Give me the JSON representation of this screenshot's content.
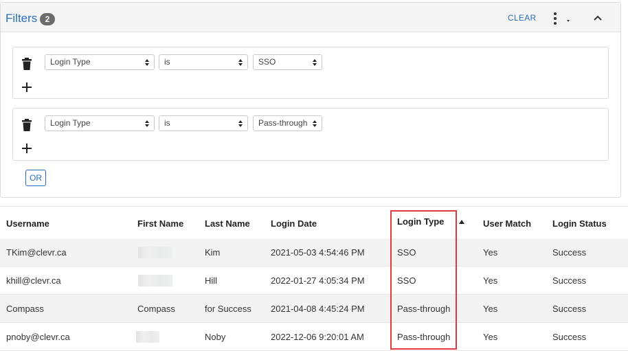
{
  "filters": {
    "title": "Filters",
    "count": "2",
    "clear_label": "CLEAR",
    "icons": {
      "delete": "trash-icon",
      "add": "plus-icon",
      "menu": "kebab-icon",
      "collapse": "chevron-up-icon"
    },
    "groups": [
      {
        "field": "Login Type",
        "operator": "is",
        "value": "SSO"
      },
      {
        "field": "Login Type",
        "operator": "is",
        "value": "Pass-through"
      }
    ],
    "or_label": "OR"
  },
  "table": {
    "columns": [
      "Username",
      "First Name",
      "Last Name",
      "Login Date",
      "Login Type",
      "User Match",
      "Login Status"
    ],
    "sorted_column": "Login Type",
    "sort_direction": "ascending",
    "rows": [
      {
        "username": "TKim@clevr.ca",
        "first_name": "",
        "last_name": "Kim",
        "login_date": "2021-05-03 4:54:46 PM",
        "login_type": "SSO",
        "user_match": "Yes",
        "login_status": "Success"
      },
      {
        "username": "khill@clevr.ca",
        "first_name": "",
        "last_name": "Hill",
        "login_date": "2022-01-27 4:05:34 PM",
        "login_type": "SSO",
        "user_match": "Yes",
        "login_status": "Success"
      },
      {
        "username": "Compass",
        "first_name": "Compass",
        "last_name": "for Success",
        "login_date": "2021-04-08 4:45:24 PM",
        "login_type": "Pass-through",
        "user_match": "Yes",
        "login_status": "Success"
      },
      {
        "username": "pnoby@clevr.ca",
        "first_name": "",
        "last_name": "Noby",
        "login_date": "2022-12-06 9:20:01 AM",
        "login_type": "Pass-through",
        "user_match": "Yes",
        "login_status": "Success"
      }
    ]
  },
  "colors": {
    "accent": "#2a6ebb",
    "highlight": "#e0393e",
    "badge": "#6c6c6c"
  }
}
